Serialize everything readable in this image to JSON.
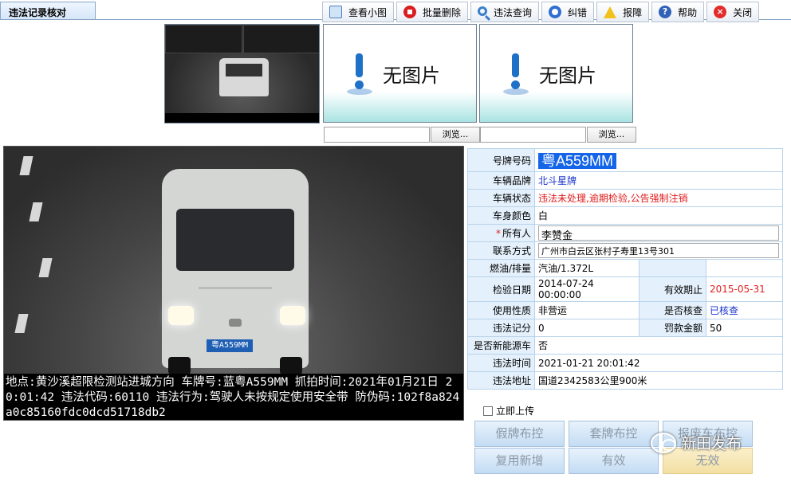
{
  "window": {
    "tab_title": "违法记录核对"
  },
  "toolbar": {
    "buttons": [
      {
        "label": "查看小图",
        "icon": "image-view-icon"
      },
      {
        "label": "批量删除",
        "icon": "delete-icon"
      },
      {
        "label": "违法查询",
        "icon": "search-icon"
      },
      {
        "label": "纠错",
        "icon": "undo-icon"
      },
      {
        "label": "报障",
        "icon": "warning-icon"
      },
      {
        "label": "帮助",
        "icon": "help-icon"
      },
      {
        "label": "关闭",
        "icon": "close-icon"
      }
    ]
  },
  "thumbnails": {
    "no_image_text": "无图片",
    "browse_label": "浏览..."
  },
  "photo": {
    "plate_text": "粤A559MM",
    "caption": "地点:黄沙溪超限检测站进城方向 车牌号:蓝粤A559MM 抓拍时间:2021年01月21日 20:01:42 违法代码:60110 违法行为:驾驶人未按规定使用安全带 防伪码:102f8a824a0c85160fdc0dcd51718db2"
  },
  "record": {
    "plate_label": "号牌号码",
    "plate_value": "粤A559MM",
    "brand_label": "车辆品牌",
    "brand_value": "北斗星牌",
    "status_label": "车辆状态",
    "status_value": "违法未处理,逾期检验,公告强制注销",
    "color_label": "车身颜色",
    "color_value": "白",
    "owner_required_mark": "*",
    "owner_label": "所有人",
    "owner_value": "李赞金",
    "contact_label": "联系方式",
    "contact_value": "广州市白云区张村子寿里13号301",
    "fuel_label": "燃油/排量",
    "fuel_value": "汽油/1.372L",
    "inspect_date_label": "检验日期",
    "inspect_date_value": "2014-07-24 00:00:00",
    "valid_until_label": "有效期止",
    "valid_until_value": "2015-05-31",
    "usage_label": "使用性质",
    "usage_value": "非营运",
    "verified_label": "是否核查",
    "verified_value": "已核查",
    "points_label": "违法记分",
    "points_value": "0",
    "fine_label": "罚款金额",
    "fine_value": "50",
    "new_energy_label": "是否新能源车",
    "new_energy_value": "否",
    "time_label": "违法时间",
    "time_value": "2021-01-21 20:01:42",
    "address_label": "违法地址",
    "address_value": "国道2342583公里900米"
  },
  "upload": {
    "label": "立即上传",
    "checked": false
  },
  "actions": {
    "fake_plate": "假牌布控",
    "cloned_plate": "套牌布控",
    "scrapped_car": "报废车布控",
    "copy_add": "复用新增",
    "valid": "有效",
    "invalid": "无效"
  },
  "watermark": {
    "text": "新田发布"
  }
}
